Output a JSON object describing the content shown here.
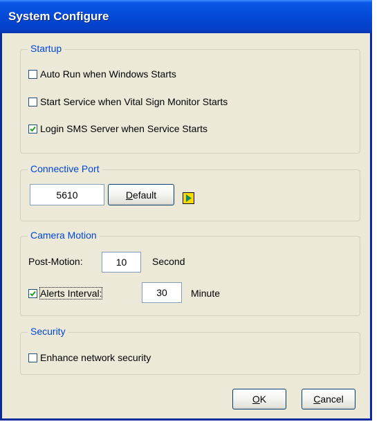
{
  "window": {
    "title": "System Configure"
  },
  "startup": {
    "legend": "Startup",
    "options": [
      {
        "label": "Auto Run when Windows Starts",
        "checked": false
      },
      {
        "label": "Start Service when Vital Sign Monitor Starts",
        "checked": false
      },
      {
        "label": "Login SMS Server when Service Starts",
        "checked": true
      }
    ]
  },
  "port": {
    "legend": "Connective Port",
    "value": "5610",
    "default_label_pre": "",
    "default_label_mn": "D",
    "default_label_post": "efault",
    "arrow_icon": "play-arrow-icon"
  },
  "camera": {
    "legend": "Camera Motion",
    "post_motion_label": "Post-Motion:",
    "post_motion_value": "10",
    "post_motion_unit": "Second",
    "alerts_label": "Alerts Interval:",
    "alerts_checked": true,
    "alerts_value": "30",
    "alerts_unit": "Minute"
  },
  "security": {
    "legend": "Security",
    "option": {
      "label": "Enhance network security",
      "checked": false
    }
  },
  "footer": {
    "ok_mn": "O",
    "ok_rest": "K",
    "cancel_mn": "C",
    "cancel_rest": "ancel"
  },
  "colors": {
    "titlebar": "#0349d6",
    "legend": "#0046d5",
    "dialog_bg": "#ece9d8",
    "arrow_fill": "#ffd800",
    "arrow_triangle": "#0a8a6a"
  }
}
